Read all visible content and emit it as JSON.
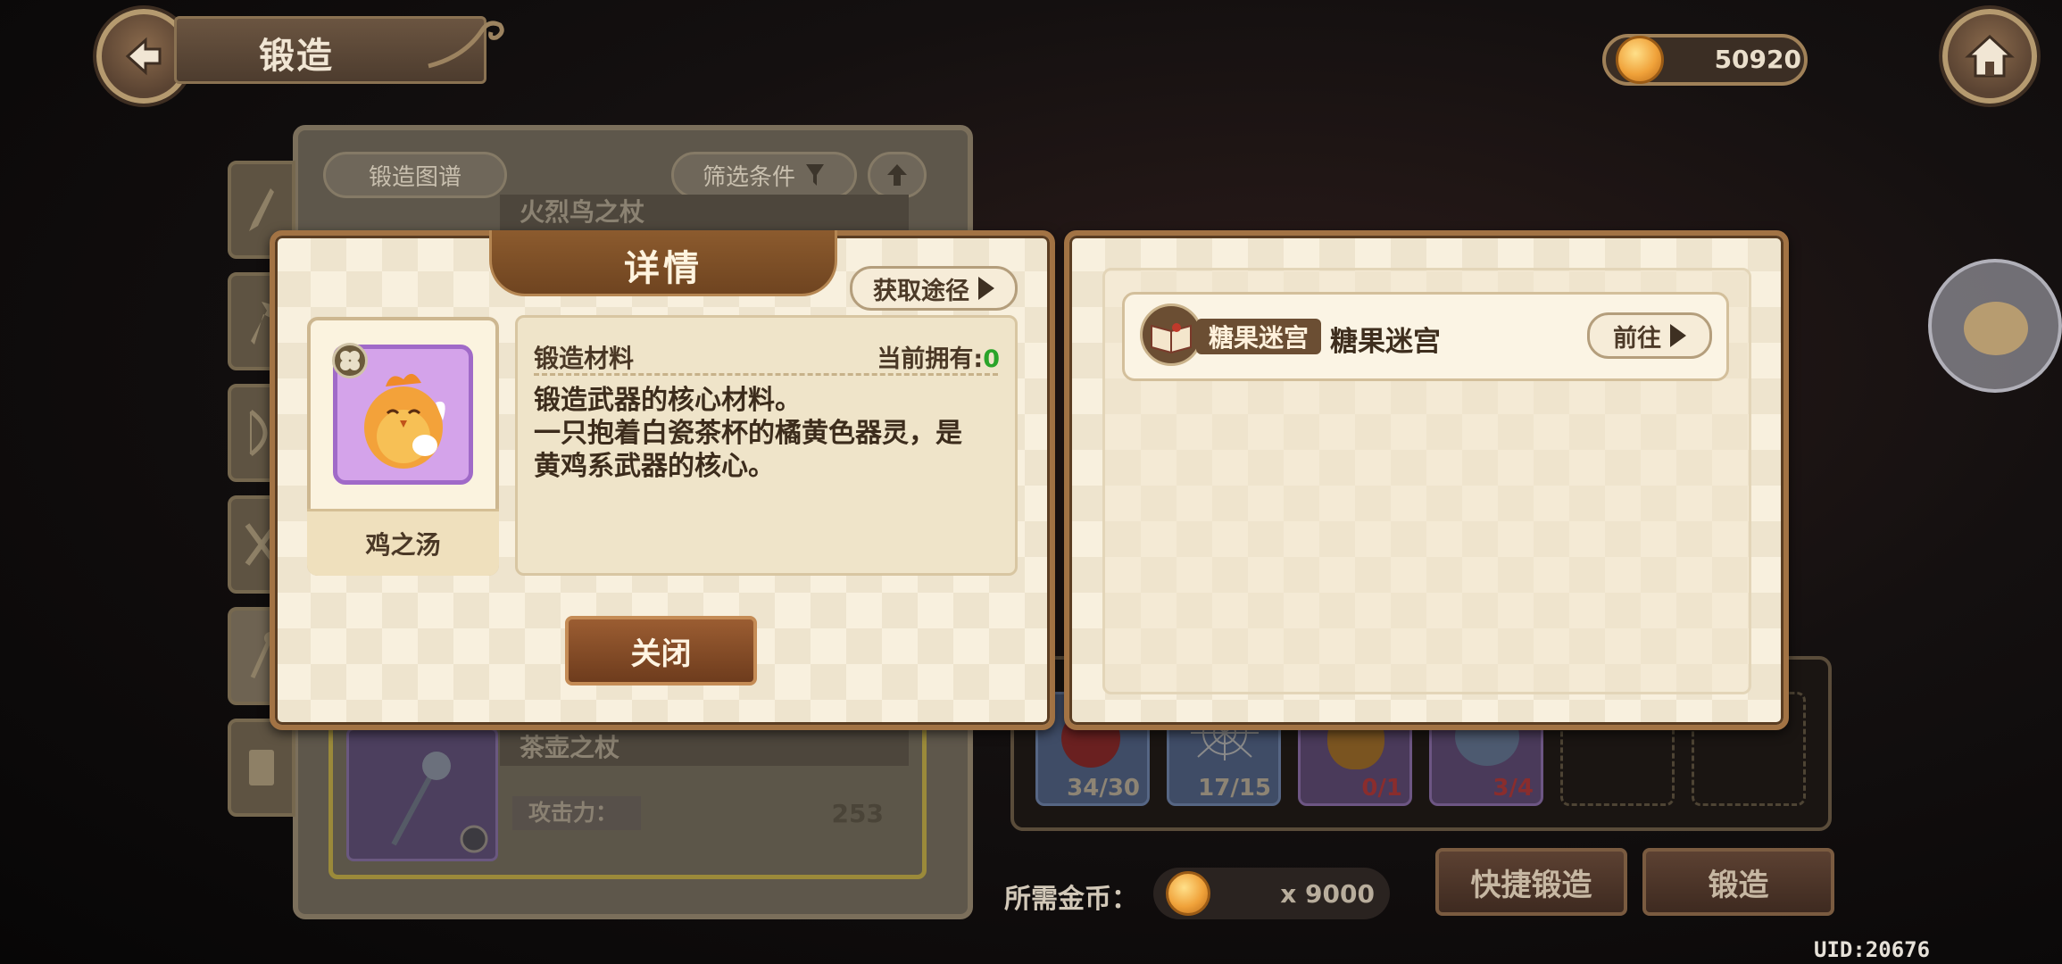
{
  "top_bar": {
    "title": "锻造",
    "coins": "50920"
  },
  "background": {
    "forge_book_label": "锻造图谱",
    "filter_label": "筛选条件",
    "weapon_name_top": "火烈鸟之杖",
    "weapon_name_bottom": "茶壶之杖",
    "attack_label": "攻击力：",
    "attack_value": "253",
    "materials": [
      {
        "count": "34/30"
      },
      {
        "count": "17/15"
      },
      {
        "count": "0/1"
      },
      {
        "count": "3/4"
      }
    ],
    "required_coins_label": "所需金币：",
    "required_coins_value": "x 9000",
    "quick_forge_label": "快捷锻造",
    "forge_label": "锻造"
  },
  "detail_dialog": {
    "title": "详情",
    "obtain_route_label": "获取途径",
    "item_name": "鸡之汤",
    "section_label": "锻造材料",
    "owned_label": "当前拥有:",
    "owned_value": "0",
    "description": [
      "锻造武器的核心材料。",
      "一只抱着白瓷茶杯的橘黄色器灵，是",
      "黄鸡系武器的核心。"
    ],
    "close_label": "关闭"
  },
  "source_panel": {
    "sources": [
      {
        "badge": "糖果迷宫",
        "name": "糖果迷宫",
        "go_label": "前往"
      }
    ]
  },
  "uid": "UID:20676",
  "colors": {
    "owned_value": "#2aa42a",
    "dialog_border": "#a27344",
    "button_brown": "#7a4523"
  }
}
